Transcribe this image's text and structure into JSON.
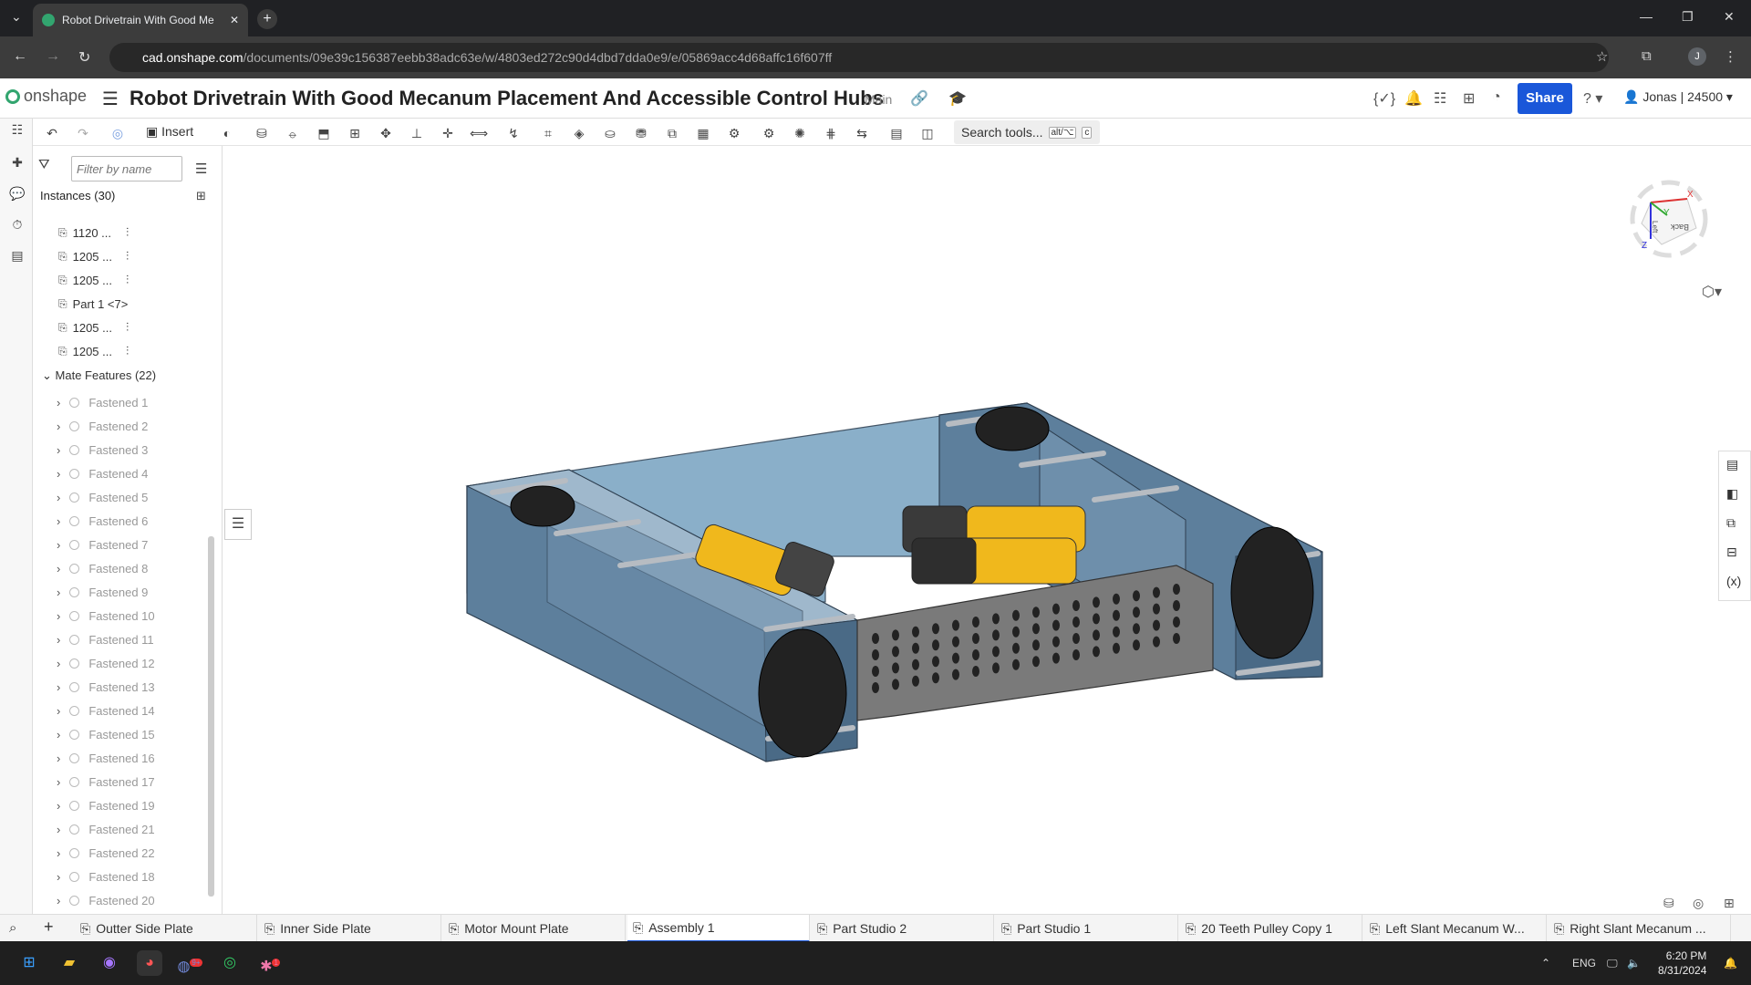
{
  "browser": {
    "tab_title": "Robot Drivetrain With Good Me",
    "url_domain": "cad.onshape.com",
    "url_path": "/documents/09e39c156387eebb38adc63e/w/4803ed272c90d4dbd7dda0e9/e/05869acc4d68affc16f607ff",
    "avatar_letter": "J"
  },
  "onshape": {
    "logo_text": "onshape",
    "doc_title": "Robot Drivetrain With Good Mecanum Placement And Accessible Control Hubs",
    "branch": "Main",
    "share_label": "Share",
    "user_label": "Jonas | 24500"
  },
  "toolbar": {
    "insert_label": "Insert",
    "search_label": "Search tools...",
    "search_kbd1": "alt/⌥",
    "search_kbd2": "c"
  },
  "tree": {
    "filter_placeholder": "Filter by name",
    "instances_label": "Instances (30)",
    "instances": [
      {
        "label": "1120 ..."
      },
      {
        "label": "1205 ..."
      },
      {
        "label": "1205 ..."
      },
      {
        "label": "Part 1 <7>"
      },
      {
        "label": "1205 ..."
      },
      {
        "label": "1205 ..."
      }
    ],
    "mate_features_label": "Mate Features (22)",
    "mates": [
      "Fastened 1",
      "Fastened 2",
      "Fastened 3",
      "Fastened 4",
      "Fastened 5",
      "Fastened 6",
      "Fastened 7",
      "Fastened 8",
      "Fastened 9",
      "Fastened 10",
      "Fastened 11",
      "Fastened 12",
      "Fastened 13",
      "Fastened 14",
      "Fastened 15",
      "Fastened 16",
      "Fastened 17",
      "Fastened 19",
      "Fastened 21",
      "Fastened 22",
      "Fastened 18",
      "Fastened 20"
    ]
  },
  "viewcube": {
    "axis_x": "X",
    "axis_y": "Y",
    "axis_z": "Z",
    "face_back": "Back",
    "face_left": "Left"
  },
  "doc_tabs": [
    {
      "label": "Outter Side Plate",
      "active": false
    },
    {
      "label": "Inner Side Plate",
      "active": false
    },
    {
      "label": "Motor Mount Plate",
      "active": false
    },
    {
      "label": "Assembly 1",
      "active": true
    },
    {
      "label": "Part Studio 2",
      "active": false
    },
    {
      "label": "Part Studio 1",
      "active": false
    },
    {
      "label": "20 Teeth Pulley Copy 1",
      "active": false
    },
    {
      "label": "Left Slant Mecanum W...",
      "active": false
    },
    {
      "label": "Right Slant Mecanum ...",
      "active": false
    }
  ],
  "taskbar": {
    "lang": "ENG",
    "time": "6:20 PM",
    "date": "8/31/2024",
    "badge_discord": "9+",
    "badge_slack": "1"
  },
  "colors": {
    "accent": "#1a57d9",
    "onshape_green": "#32a56f",
    "plate_blue": "#5d7f9c",
    "motor_yellow": "#f0b81c"
  }
}
